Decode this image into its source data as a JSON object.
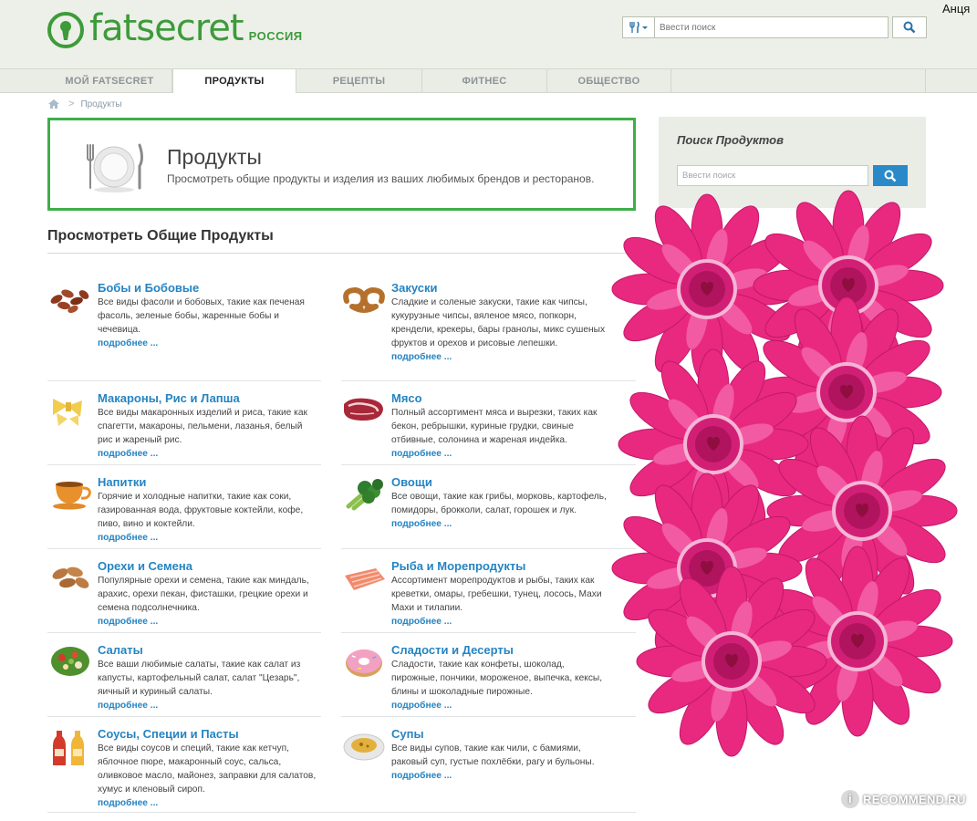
{
  "header": {
    "logo_text": "fatsecret",
    "logo_country": "РОССИЯ",
    "search_placeholder": "Ввести поиск",
    "username": "Анця"
  },
  "nav": {
    "tabs": [
      {
        "label": "МОЙ FATSECRET",
        "active": false
      },
      {
        "label": "ПРОДУКТЫ",
        "active": true
      },
      {
        "label": "РЕЦЕПТЫ",
        "active": false
      },
      {
        "label": "ФИТНЕС",
        "active": false
      },
      {
        "label": "ОБЩЕСТВО",
        "active": false
      }
    ]
  },
  "breadcrumb": {
    "current": "Продукты"
  },
  "banner": {
    "title": "Продукты",
    "subtitle": "Просмотреть общие продукты и изделия из ваших любимых брендов и ресторанов."
  },
  "section": {
    "title": "Просмотреть Общие Продукты"
  },
  "more_label": "подробнее ...",
  "categories": [
    {
      "title": "Бобы и Бобовые",
      "desc": "Все виды фасоли и бобовых, такие как печеная фасоль, зеленые бобы, жаренные бобы и чечевица.",
      "icon": "beans-icon"
    },
    {
      "title": "Закуски",
      "desc": "Сладкие и соленые закуски, такие как чипсы, кукурузные чипсы, вяленое мясо, попкорн, крендели, крекеры, бары гранолы, микс сушеных фруктов и орехов и рисовые лепешки.",
      "icon": "pretzel-icon"
    },
    {
      "title": "Макароны, Рис и Лапша",
      "desc": "Все виды макаронных изделий и риса, такие как спагетти, макароны, пельмени, лазанья, белый рис и жареный рис.",
      "icon": "pasta-icon"
    },
    {
      "title": "Мясо",
      "desc": "Полный ассортимент мяса и вырезки, таких как бекон, ребрышки, куриные грудки, свиные отбивные, солонина и жареная индейка.",
      "icon": "steak-icon"
    },
    {
      "title": "Напитки",
      "desc": "Горячие и холодные напитки, такие как соки, газированная вода, фруктовые коктейли, кофе, пиво, вино и коктейли.",
      "icon": "cup-icon"
    },
    {
      "title": "Овощи",
      "desc": "Все овощи, такие как грибы, морковь, картофель, помидоры, брокколи, салат, горошек и лук.",
      "icon": "broccoli-icon"
    },
    {
      "title": "Орехи и Семена",
      "desc": "Популярные орехи и семена, такие как миндаль, арахис, орехи пекан, фисташки, грецкие орехи и семена подсолнечника.",
      "icon": "almonds-icon"
    },
    {
      "title": "Рыба и Морепродукты",
      "desc": "Ассортимент морепродуктов и рыбы, таких как креветки, омары, гребешки, тунец, лосось, Махи Махи и тилапии.",
      "icon": "salmon-icon"
    },
    {
      "title": "Салаты",
      "desc": "Все ваши любимые салаты, такие как салат из капусты, картофельный салат, салат \"Цезарь\", яичный и куриный салаты.",
      "icon": "salad-icon"
    },
    {
      "title": "Сладости и Десерты",
      "desc": "Сладости, такие как конфеты, шоколад, пирожные, пончики, мороженое, выпечка, кексы, блины и шоколадные пирожные.",
      "icon": "donut-icon"
    },
    {
      "title": "Соусы, Специи и Пасты",
      "desc": "Все виды соусов и специй, такие как кетчуп, яблочное пюре, макаронный соус, сальса, оливковое масло, майонез, заправки для салатов, хумус и кленовый сироп.",
      "icon": "sauce-bottles-icon"
    },
    {
      "title": "Супы",
      "desc": "Все виды супов, такие как чили, с бамиями, раковый суп, густые похлёбки, рагу и бульоны.",
      "icon": "soup-icon"
    }
  ],
  "sidebar": {
    "title": "Поиск Продуктов",
    "placeholder": "Ввести поиск"
  },
  "watermark": {
    "text": "RECOMMEND.RU"
  },
  "colors": {
    "brand_green": "#3d9b3a",
    "link_blue": "#2584c2",
    "flower_pink": "#e8297f"
  }
}
